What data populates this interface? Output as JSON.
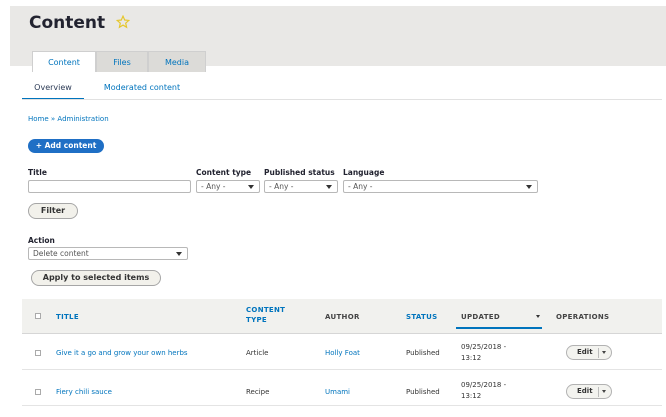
{
  "header": {
    "title": "Content"
  },
  "primary_tabs": [
    {
      "label": "Content",
      "active": true
    },
    {
      "label": "Files",
      "active": false
    },
    {
      "label": "Media",
      "active": false
    }
  ],
  "secondary_tabs": [
    {
      "label": "Overview",
      "active": true
    },
    {
      "label": "Moderated content",
      "active": false
    }
  ],
  "breadcrumb": "Home » Administration",
  "add_button": "+ Add content",
  "filters": {
    "title_label": "Title",
    "title_value": "",
    "content_type_label": "Content type",
    "content_type_value": "- Any -",
    "published_label": "Published status",
    "published_value": "- Any -",
    "language_label": "Language",
    "language_value": "- Any -",
    "filter_button": "Filter"
  },
  "action": {
    "label": "Action",
    "value": "Delete content",
    "apply_button": "Apply to selected items"
  },
  "table": {
    "headers": {
      "title": "TITLE",
      "content_type_1": "CONTENT",
      "content_type_2": "TYPE",
      "author": "AUTHOR",
      "status": "STATUS",
      "updated": "UPDATED",
      "operations": "OPERATIONS"
    },
    "rows": [
      {
        "title": "Give it a go and grow your own herbs",
        "type": "Article",
        "author": "Holly Foat",
        "status": "Published",
        "updated_1": "09/25/2018 -",
        "updated_2": "13:12",
        "op": "Edit"
      },
      {
        "title": "Fiery chili sauce",
        "type": "Recipe",
        "author": "Umami",
        "status": "Published",
        "updated_1": "09/25/2018 -",
        "updated_2": "13:12",
        "op": "Edit"
      }
    ]
  },
  "colors": {
    "link": "#0074bd",
    "primary_button": "#1f6fc5",
    "header_bg": "#e9e8e6",
    "star": "#e5c62a"
  }
}
